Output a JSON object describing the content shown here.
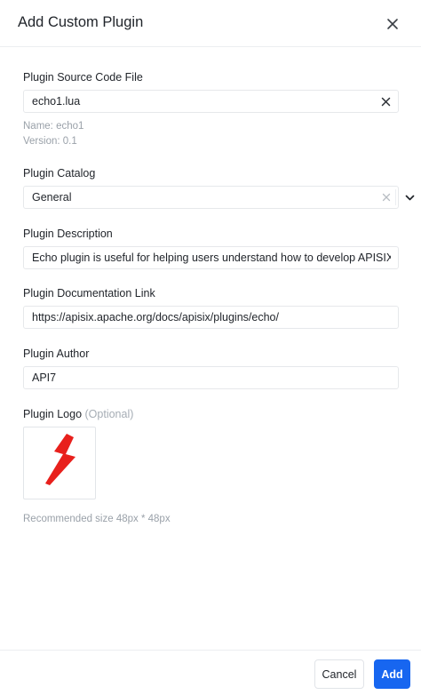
{
  "dialog": {
    "title": "Add Custom Plugin"
  },
  "source_file": {
    "label": "Plugin Source Code File",
    "value": "echo1.lua",
    "name_line": "Name: echo1",
    "version_line": "Version: 0.1"
  },
  "catalog": {
    "label": "Plugin Catalog",
    "value": "General"
  },
  "description": {
    "label": "Plugin Description",
    "value": "Echo plugin is useful for helping users understand how to develop APISIX plugins."
  },
  "doc_link": {
    "label": "Plugin Documentation Link",
    "value": "https://apisix.apache.org/docs/apisix/plugins/echo/"
  },
  "author": {
    "label": "Plugin Author",
    "value": "API7"
  },
  "logo": {
    "label": "Plugin Logo",
    "optional": "(Optional)",
    "hint": "Recommended size 48px * 48px",
    "icon": "red-lightning-bolt",
    "color": "#e8201c"
  },
  "footer": {
    "cancel_label": "Cancel",
    "add_label": "Add"
  },
  "colors": {
    "primary": "#1766f0"
  }
}
